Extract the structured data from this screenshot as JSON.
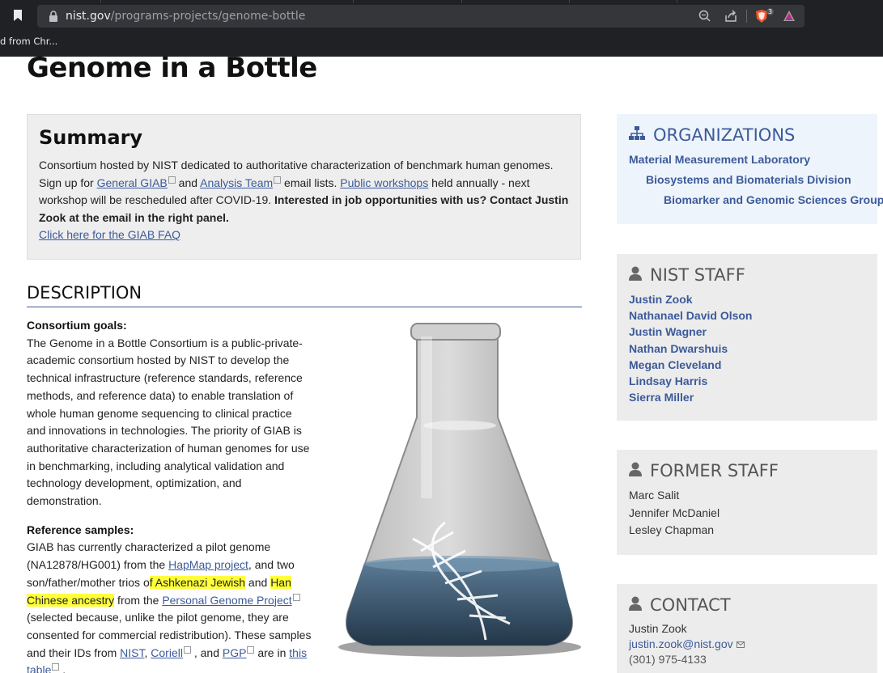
{
  "browser": {
    "url_host": "nist.gov",
    "url_path": "/programs-projects/genome-bottle",
    "bookmark_bar_text": "d from Chr...",
    "extension_badge": "3"
  },
  "page": {
    "title": "Genome in a Bottle",
    "summary": {
      "heading": "Summary",
      "text_1": "Consortium hosted by NIST dedicated to authoritative characterization of benchmark human genomes. Sign up for ",
      "link_general": "General GIAB",
      "text_2": " and ",
      "link_analysis": "Analysis Team",
      "text_3": " email lists. ",
      "link_workshops": "Public workshops",
      "text_4": " held annually - next workshop will be rescheduled after COVID-19. ",
      "bold_text": "Interested in job opportunities with us? Contact Justin Zook at the email in the right panel.",
      "faq_link": "Click here for the GIAB FAQ"
    },
    "description": {
      "heading": "DESCRIPTION",
      "goals_heading": "Consortium goals:",
      "goals_text": "The Genome in a Bottle Consortium is a public-private-academic consortium hosted by NIST to develop the technical infrastructure (reference standards, reference methods, and reference data) to enable translation of whole human genome sequencing to clinical practice and innovations in technologies. The priority of GIAB is authoritative characterization of human genomes for use in benchmarking, including analytical validation and technology development, optimization, and demonstration.",
      "ref_heading": "Reference samples:",
      "ref_t1": "GIAB has currently characterized a pilot genome (NA12878/HG001) from the ",
      "ref_link_hapmap": "HapMap project",
      "ref_t2": ",  and two son/father/mother trios o",
      "ref_hl1": "f Ashkenazi Jewish",
      "ref_t3": " and ",
      "ref_hl2": "Han Chinese ancestry",
      "ref_t4": " from the ",
      "ref_link_pgp": "Personal Genome Project",
      "ref_t5": " (selected because, unlike the pilot genome, they are consented for commercial redistribution).  These samples and their IDs from ",
      "ref_link_nist": "NIST",
      "ref_t6": ", ",
      "ref_link_coriell": "Coriell",
      "ref_t7": " , and ",
      "ref_link_pgp2": "PGP",
      "ref_t8": "  are in ",
      "ref_link_this": "this table",
      "ref_t9": " ."
    }
  },
  "sidebar": {
    "organizations": {
      "heading": "ORGANIZATIONS",
      "items": [
        "Material Measurement Laboratory",
        "Biosystems and Biomaterials Division",
        "Biomarker and Genomic Sciences Group"
      ]
    },
    "nist_staff": {
      "heading": "NIST STAFF",
      "items": [
        "Justin Zook",
        "Nathanael David Olson",
        "Justin Wagner",
        "Nathan Dwarshuis",
        "Megan Cleveland",
        "Lindsay Harris",
        "Sierra Miller"
      ]
    },
    "former_staff": {
      "heading": "FORMER STAFF",
      "items": [
        "Marc Salit",
        "Jennifer McDaniel",
        "Lesley Chapman"
      ]
    },
    "contact": {
      "heading": "CONTACT",
      "name": "Justin Zook",
      "email": "justin.zook@nist.gov",
      "phone": "(301) 975-4133"
    }
  },
  "colors": {
    "link": "#3c5a9a",
    "highlight": "#ffff3b",
    "chrome_bg": "#202124"
  }
}
